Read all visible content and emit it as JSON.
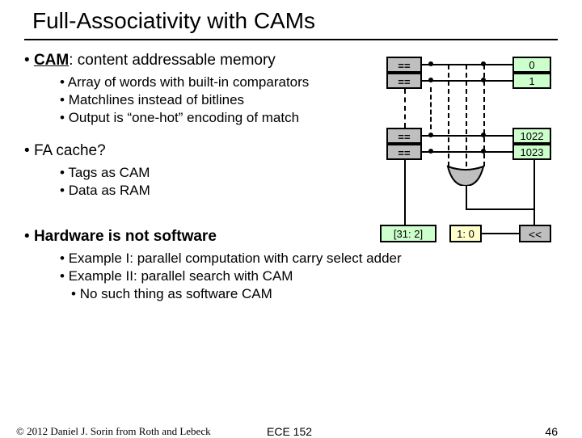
{
  "title": "Full-Associativity with CAMs",
  "bullets": {
    "cam_label": "CAM",
    "cam_rest": ": content addressable memory",
    "cam_sub1": "Array of words with built-in comparators",
    "cam_sub2": "Matchlines instead of bitlines",
    "cam_sub3": "Output is “one-hot” encoding of match",
    "fa": "FA cache?",
    "fa_sub1": "Tags as CAM",
    "fa_sub2": "Data as RAM",
    "hw": "Hardware is not software",
    "hw_sub1": "Example I: parallel computation with carry select adder",
    "hw_sub2": "Example II: parallel search with CAM",
    "hw_sub3": "No such thing as software CAM"
  },
  "diagram": {
    "eq": "==",
    "idx0": "0",
    "idx1": "1",
    "idx2": "1022",
    "idx3": "1023",
    "tag_field": "[31: 2]",
    "off_field": "1: 0",
    "shift": "<<"
  },
  "footer": {
    "copyright": "© 2012 Daniel J. Sorin from Roth and Lebeck",
    "course": "ECE 152",
    "page": "46"
  }
}
